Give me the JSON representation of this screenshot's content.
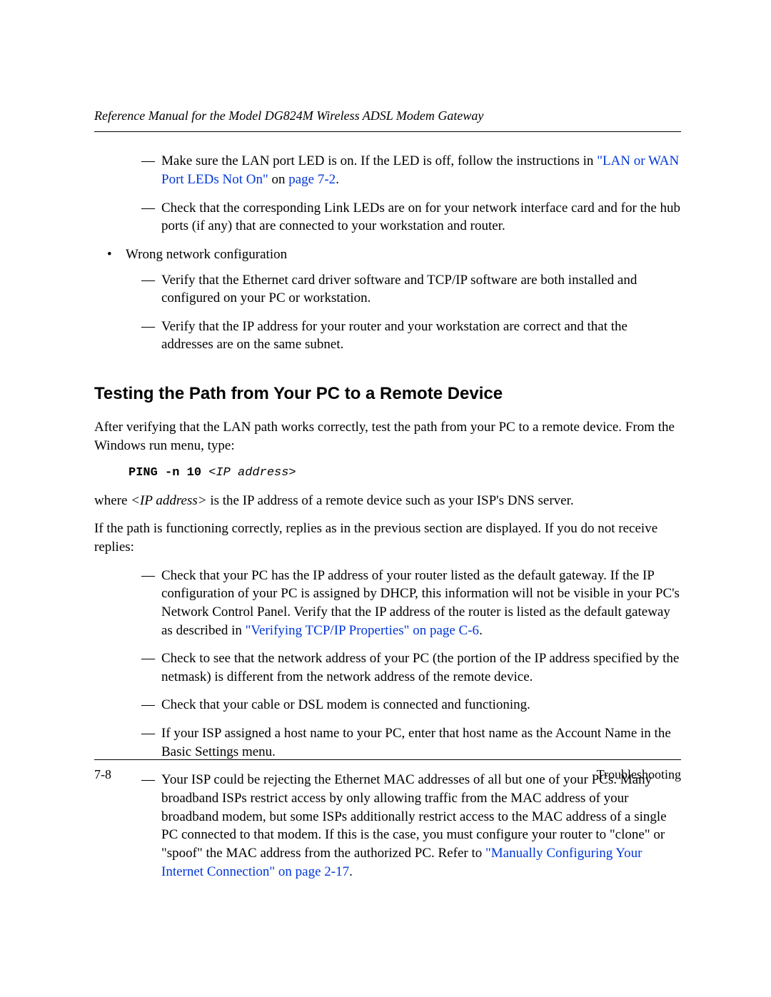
{
  "header": {
    "running_title": "Reference Manual for the Model DG824M Wireless ADSL Modem Gateway"
  },
  "top_list": {
    "dash1_pre": "Make sure the LAN port LED is on. If the LED is off, follow the instructions in ",
    "dash1_link": "\"LAN or WAN Port LEDs Not On\"",
    "dash1_mid": " on ",
    "dash1_page": "page 7-2",
    "dash1_post": ".",
    "dash2": "Check that the corresponding Link LEDs are on for your network interface card and for the hub ports (if any) that are connected to your workstation and router.",
    "bullet2": "Wrong network configuration",
    "dash3": "Verify that the Ethernet card driver software and TCP/IP software are both installed and configured on your PC or workstation.",
    "dash4": "Verify that the IP address for your router and your workstation are correct and that the addresses are on the same subnet."
  },
  "section": {
    "title": "Testing the Path from Your PC to a Remote Device",
    "p1": "After verifying that the LAN path works correctly, test the path from your PC to a remote device. From the Windows run menu, type:",
    "cmd_prefix": "PING -n 10 ",
    "cmd_arg": "<IP address>",
    "p2_pre": "where ",
    "p2_ital": "<IP address>",
    "p2_post": " is the IP address of a remote device such as your ISP's DNS server.",
    "p3": "If the path is functioning correctly, replies as in the previous section are displayed. If you do not receive replies:",
    "d1_pre": "Check that your PC has the IP address of your router listed as the default gateway. If the IP configuration of your PC is assigned by DHCP, this information will not be visible in your PC's Network Control Panel. Verify that the IP address of the router is listed as the default gateway as described in ",
    "d1_link": "\"Verifying TCP/IP Properties\" on page C-6",
    "d1_post": ".",
    "d2": "Check to see that the network address of your PC (the portion of the IP address specified by the netmask) is different from the network address of the remote device.",
    "d3": "Check that your cable or DSL modem is connected and functioning.",
    "d4": "If your ISP assigned a host name to your PC, enter that host name as the Account Name in the Basic Settings menu.",
    "d5_pre": "Your ISP could be rejecting the Ethernet MAC addresses of all but one of your PCs. Many broadband ISPs restrict access by only allowing traffic from the MAC address of your broadband modem, but some ISPs additionally restrict access to the MAC address of a single PC connected to that modem. If this is the case, you must configure your router to \"clone\" or \"spoof\" the MAC address from the authorized PC. Refer to ",
    "d5_link": "\"Manually Configuring Your Internet Connection\" on page 2-17",
    "d5_post": "."
  },
  "footer": {
    "page_num": "7-8",
    "section_name": "Troubleshooting"
  }
}
